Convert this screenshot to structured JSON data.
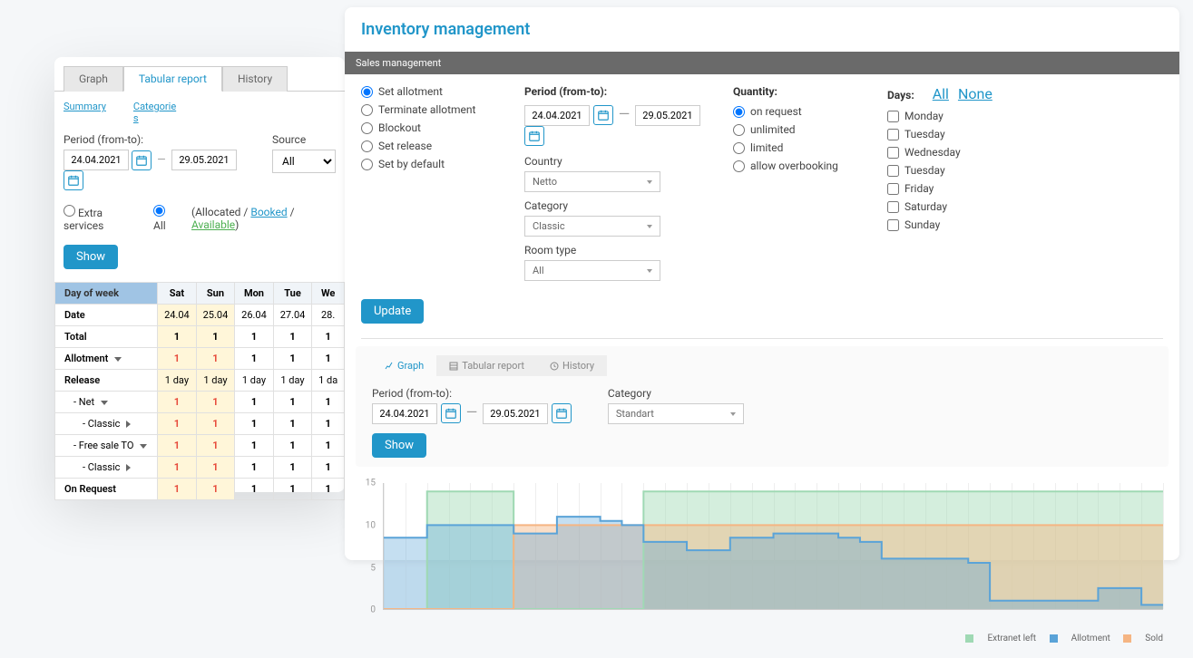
{
  "left": {
    "tabs": {
      "graph": "Graph",
      "tabular": "Tabular report",
      "history": "History",
      "active": "tabular"
    },
    "sub_tabs": {
      "summary": "Summary",
      "categories": "Categories"
    },
    "period_label": "Period (from-to):",
    "date_from": "24.04.2021",
    "date_to": "29.05.2021",
    "source_label": "Source",
    "source_value": "All",
    "filter": {
      "extra": "Extra services",
      "all": "All",
      "allocated": "Allocated",
      "booked": "Booked",
      "available": "Available"
    },
    "show_btn": "Show",
    "table": {
      "header": "Day of week",
      "cols": [
        "Sat",
        "Sun",
        "Mon",
        "Tue",
        "We"
      ],
      "rows": [
        {
          "label": "Date",
          "vals": [
            "24.04",
            "25.04",
            "26.04",
            "27.04",
            "28."
          ],
          "hl": [
            0,
            1
          ]
        },
        {
          "label": "Total",
          "vals": [
            "1",
            "1",
            "1",
            "1",
            "1"
          ],
          "hl": [
            0,
            1
          ],
          "bold": true
        },
        {
          "label": "Allotment",
          "vals": [
            "1",
            "1",
            "1",
            "1",
            "1"
          ],
          "hl": [
            0,
            1
          ],
          "bold": true,
          "red": [
            0,
            1
          ],
          "tri": "down"
        },
        {
          "label": "Release",
          "vals": [
            "1 day",
            "1 day",
            "1 day",
            "1 day",
            "1 da"
          ],
          "hl": [
            0,
            1
          ]
        },
        {
          "label": "- Net",
          "vals": [
            "1",
            "1",
            "1",
            "1",
            "1"
          ],
          "hl": [
            0,
            1
          ],
          "bold": true,
          "red": [
            0,
            1
          ],
          "indent": 1,
          "tri": "down"
        },
        {
          "label": "- Classic",
          "vals": [
            "1",
            "1",
            "1",
            "1",
            "1"
          ],
          "hl": [
            0,
            1
          ],
          "bold": true,
          "red": [
            0,
            1
          ],
          "indent": 2,
          "tri": "right"
        },
        {
          "label": "- Free sale TO",
          "vals": [
            "1",
            "1",
            "1",
            "1",
            "1"
          ],
          "hl": [
            0,
            1
          ],
          "bold": true,
          "red": [
            0,
            1
          ],
          "indent": 1,
          "tri": "down"
        },
        {
          "label": "- Classic",
          "vals": [
            "1",
            "1",
            "1",
            "1",
            "1"
          ],
          "hl": [
            0,
            1
          ],
          "bold": true,
          "red": [
            0,
            1
          ],
          "indent": 2,
          "tri": "right"
        },
        {
          "label": "On Request",
          "vals": [
            "1",
            "1",
            "1",
            "1",
            "1"
          ],
          "hl": [
            0,
            1
          ],
          "bold": true,
          "red": [
            0,
            1
          ]
        }
      ]
    }
  },
  "right": {
    "title": "Inventory management",
    "bar": "Sales management",
    "actions": [
      {
        "label": "Set allotment",
        "checked": true
      },
      {
        "label": "Terminate allotment"
      },
      {
        "label": "Blockout"
      },
      {
        "label": "Set release"
      },
      {
        "label": "Set by default"
      }
    ],
    "period_label": "Period (from-to):",
    "date_from": "24.04.2021",
    "date_to": "29.05.2021",
    "country_label": "Country",
    "country_value": "Netto",
    "category_label": "Category",
    "category_value": "Classic",
    "roomtype_label": "Room type",
    "roomtype_value": "All",
    "quantity_label": "Quantity:",
    "quantity_opts": [
      {
        "label": "on request",
        "checked": true
      },
      {
        "label": "unlimited"
      },
      {
        "label": "limited"
      },
      {
        "label": "allow overbooking"
      }
    ],
    "days_label": "Days:",
    "days_all": "All",
    "days_none": "None",
    "days": [
      "Monday",
      "Tuesday",
      "Wednesday",
      "Tuesday",
      "Friday",
      "Saturday",
      "Sunday"
    ],
    "update_btn": "Update",
    "sub": {
      "tabs": {
        "graph": "Graph",
        "tabular": "Tabular report",
        "history": "History"
      },
      "period_label": "Period (from-to):",
      "date_from": "24.04.2021",
      "date_to": "29.05.2021",
      "category_label": "Category",
      "category_value": "Standart",
      "show_btn": "Show"
    },
    "legend": {
      "extranet": "Extranet left",
      "allotment": "Allotment",
      "sold": "Sold"
    }
  },
  "chart_data": {
    "type": "area",
    "ylim": [
      0,
      15
    ],
    "yticks": [
      0,
      5,
      10,
      15
    ],
    "x_count": 36,
    "series": [
      {
        "name": "Extranet left",
        "color": "#9fd9b4",
        "fill": "rgba(159,217,180,.45)",
        "y": [
          0,
          0,
          14,
          14,
          14,
          14,
          0,
          0,
          0,
          0,
          0,
          0,
          14,
          14,
          14,
          14,
          14,
          14,
          14,
          14,
          14,
          14,
          14,
          14,
          14,
          14,
          14,
          14,
          14,
          14,
          14,
          14,
          14,
          14,
          14,
          14
        ]
      },
      {
        "name": "Sold",
        "color": "#f5b583",
        "fill": "rgba(245,181,131,.45)",
        "y": [
          0,
          0,
          0,
          0,
          0,
          0,
          10,
          10,
          10,
          10,
          10,
          10,
          10,
          10,
          10,
          10,
          10,
          10,
          10,
          10,
          10,
          10,
          10,
          10,
          10,
          10,
          10,
          10,
          10,
          10,
          10,
          10,
          10,
          10,
          10,
          10
        ]
      },
      {
        "name": "Allotment",
        "color": "#5aa3d8",
        "fill": "rgba(90,163,216,.35)",
        "y": [
          8.5,
          8.5,
          10,
          10,
          10,
          10,
          9,
          9,
          11,
          11,
          10.5,
          10,
          8,
          8,
          7,
          7,
          8.5,
          8.5,
          9,
          9,
          9,
          8.5,
          8,
          6,
          6,
          6,
          6,
          5.5,
          1,
          1,
          1,
          1,
          1,
          2.5,
          2.5,
          0.5
        ]
      }
    ]
  }
}
